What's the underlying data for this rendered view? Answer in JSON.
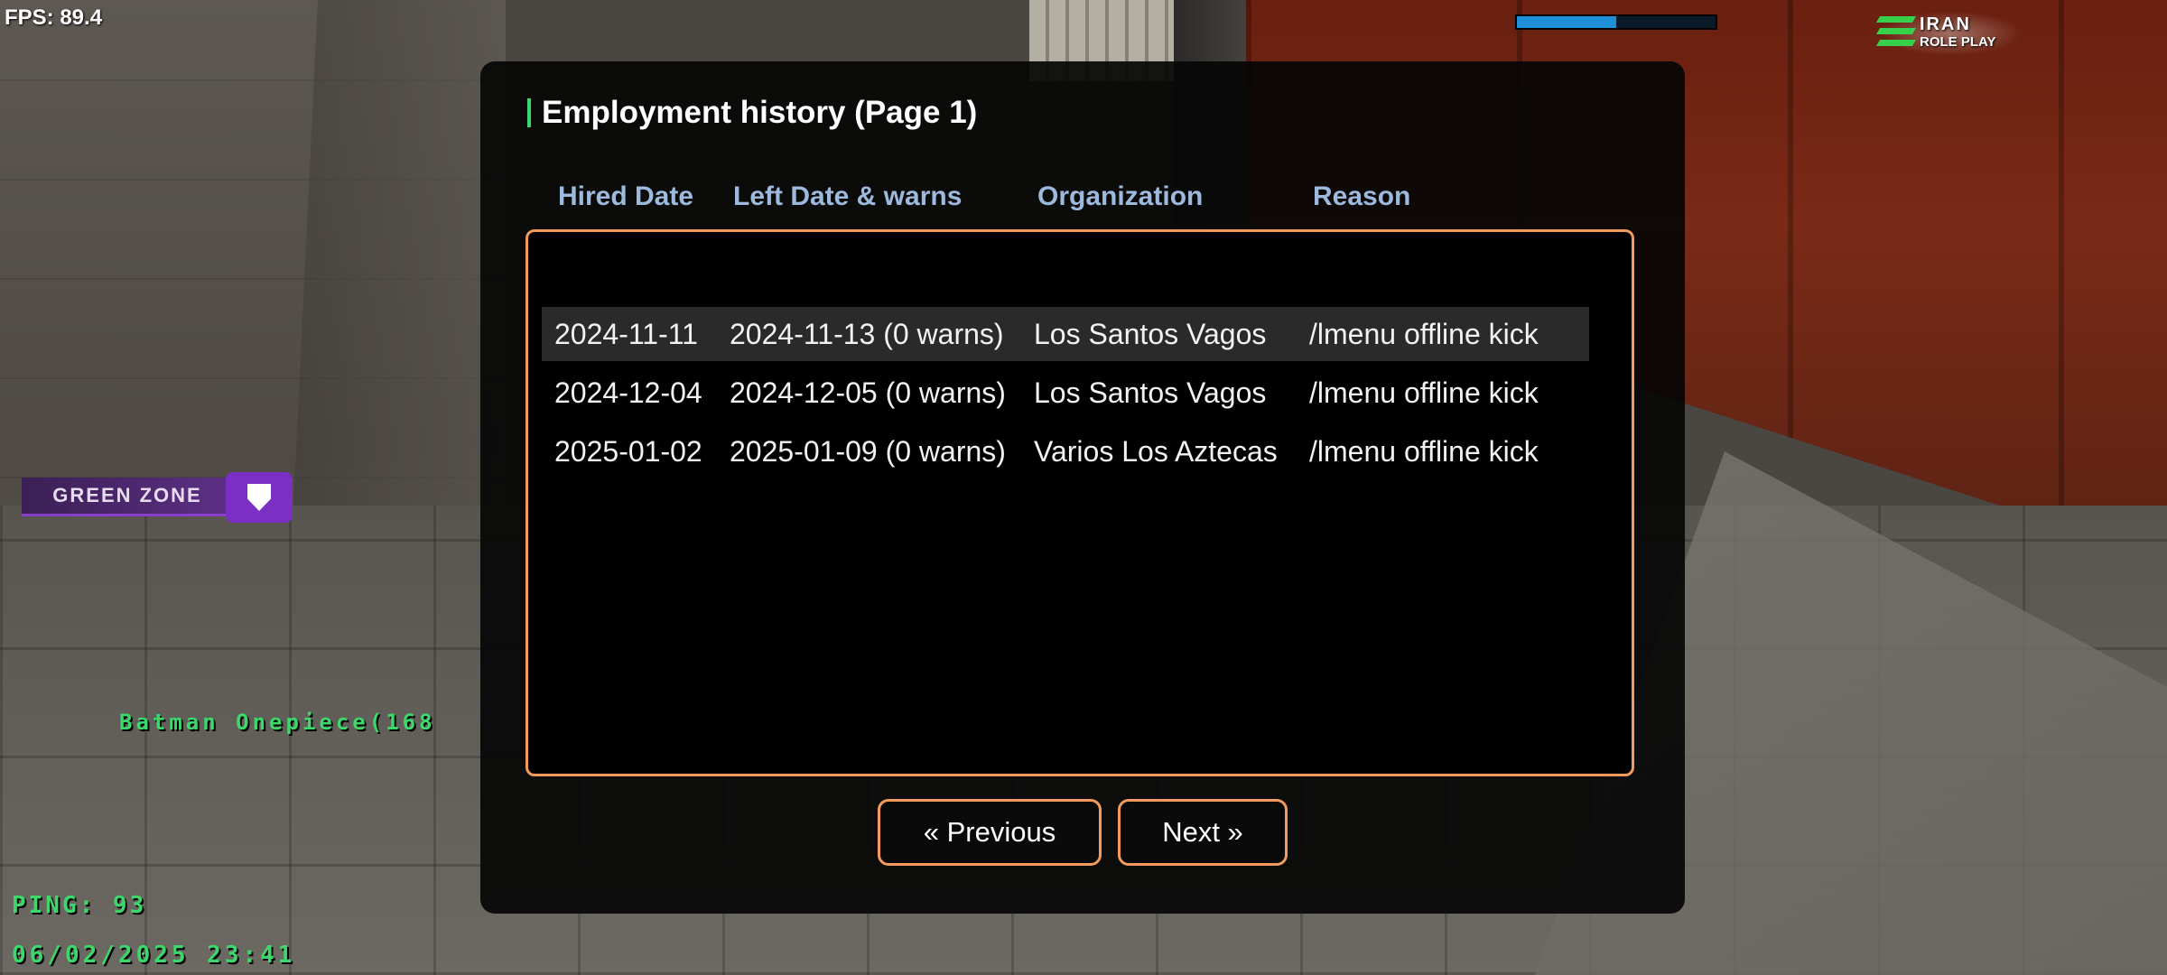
{
  "hud": {
    "fps": "FPS: 89.4",
    "health_percent": 50,
    "logo_line1": "IRAN",
    "logo_line2": "ROLE PLAY",
    "zone_label": "GREEN ZONE",
    "player_name": "Batman Onepiece(168",
    "ping": "PING: 93",
    "datetime": "06/02/2025 23:41"
  },
  "dialog": {
    "title": "Employment history (Page 1)",
    "columns": [
      "Hired Date",
      "Left Date & warns",
      "Organization",
      "Reason"
    ],
    "rows": [
      {
        "hired": "2024-11-11",
        "left": "2024-11-13 (0 warns)",
        "org": "Los Santos Vagos",
        "reason": "/lmenu offline kick"
      },
      {
        "hired": "2024-12-04",
        "left": "2024-12-05 (0 warns)",
        "org": "Los Santos Vagos",
        "reason": "/lmenu offline kick"
      },
      {
        "hired": "2025-01-02",
        "left": "2025-01-09 (0 warns)",
        "org": "Varios Los Aztecas",
        "reason": "/lmenu offline kick"
      }
    ],
    "prev_label": "« Previous",
    "next_label": "Next »"
  },
  "colors": {
    "accent_green": "#3dd86c",
    "dialog_border": "#f39b5e",
    "header_text": "#9db9dd",
    "zone_purple": "#7c2fc4"
  }
}
